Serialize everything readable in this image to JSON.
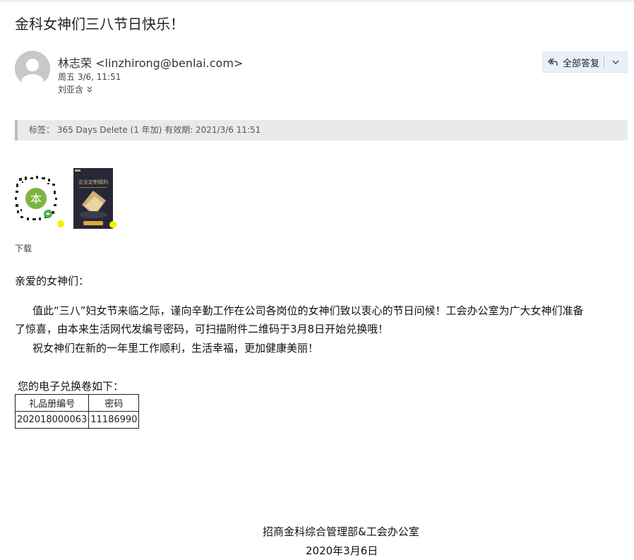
{
  "email": {
    "subject": "金科女神们三八节日快乐！",
    "sender": "林志荣 <linzhirong@benlai.com>",
    "sent_time": "周五 3/6, 11:51",
    "recipient": "刘亚含",
    "reply_all_label": "全部答复",
    "tag_text": "标签： 365 Days Delete (1 年加) 有效期: 2021/3/6 11:51"
  },
  "attachments": {
    "qr_center_char": "本",
    "poster_title": "企业定制福利",
    "download_label": "下载"
  },
  "body": {
    "greeting": "亲爱的女神们：",
    "line1": "值此“三八”妇女节来临之际，谨向辛勤工作在公司各岗位的女神们致以衷心的节日问候！工会办公室为广大女神们准备",
    "line2": "了惊喜，由本来生活网代发编号密码，可扫描附件二维码于3月8日开始兑换哦！",
    "line3": "祝女神们在新的一年里工作顺利，生活幸福，更加健康美丽！",
    "voucher_intro": "您的电子兑换卷如下："
  },
  "table": {
    "headers": [
      "礼品册编号",
      "密码"
    ],
    "rows": [
      [
        "202018000063",
        "11186990"
      ]
    ]
  },
  "signature": {
    "org": "招商金科综合管理部&工会办公室",
    "date": "2020年3月6日"
  },
  "colors": {
    "reply_button_bg": "#e8f1fa",
    "tag_bar_bg": "#eaeaea",
    "qr_green": "#7cb342",
    "marker_yellow": "#f2f200"
  },
  "icons": {
    "avatar": "person-silhouette-icon",
    "reply_all": "reply-all-icon",
    "dropdown": "chevron-down-icon",
    "recipient_expand": "double-chevron-down-icon"
  }
}
